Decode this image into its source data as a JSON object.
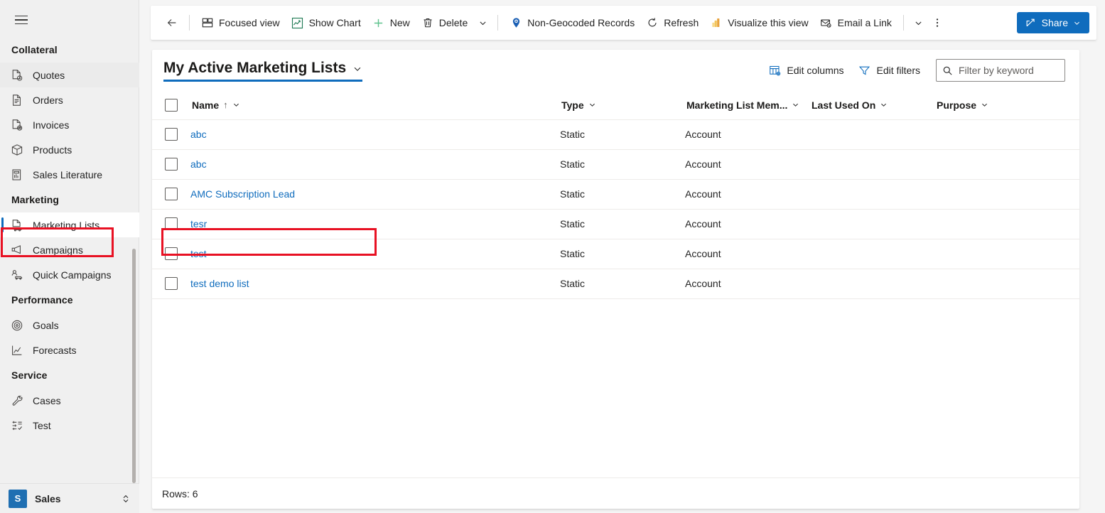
{
  "sidebar": {
    "hamburger_label": "site-map-toggle",
    "groups": [
      {
        "title": "Collateral",
        "items": [
          {
            "label": "Quotes",
            "icon": "quote-document-icon",
            "state": "hovered"
          },
          {
            "label": "Orders",
            "icon": "order-document-icon",
            "state": "normal"
          },
          {
            "label": "Invoices",
            "icon": "invoice-document-icon",
            "state": "normal"
          },
          {
            "label": "Products",
            "icon": "product-box-icon",
            "state": "normal"
          },
          {
            "label": "Sales Literature",
            "icon": "sales-literature-icon",
            "state": "normal"
          }
        ]
      },
      {
        "title": "Marketing",
        "items": [
          {
            "label": "Marketing Lists",
            "icon": "marketing-list-icon",
            "state": "selected"
          },
          {
            "label": "Campaigns",
            "icon": "megaphone-icon",
            "state": "normal"
          },
          {
            "label": "Quick Campaigns",
            "icon": "quick-campaign-icon",
            "state": "normal"
          }
        ]
      },
      {
        "title": "Performance",
        "items": [
          {
            "label": "Goals",
            "icon": "target-icon",
            "state": "normal"
          },
          {
            "label": "Forecasts",
            "icon": "line-chart-icon",
            "state": "normal"
          }
        ]
      },
      {
        "title": "Service",
        "items": [
          {
            "label": "Cases",
            "icon": "wrench-icon",
            "state": "normal"
          },
          {
            "label": "Test",
            "icon": "settings-list-icon",
            "state": "normal"
          }
        ]
      }
    ],
    "app_switcher": {
      "badge": "S",
      "name": "Sales",
      "chevron": "app-switcher-chevron-icon"
    }
  },
  "commandbar": {
    "back": "back-arrow-icon",
    "buttons": [
      {
        "label": "Focused view",
        "icon": "focused-view-icon"
      },
      {
        "label": "Show Chart",
        "icon": "show-chart-icon"
      },
      {
        "label": "New",
        "icon": "plus-icon"
      },
      {
        "label": "Delete",
        "icon": "trash-icon"
      }
    ],
    "overflow_caret_1": "chevron-down-icon",
    "buttons2": [
      {
        "label": "Non-Geocoded Records",
        "icon": "map-pin-icon"
      },
      {
        "label": "Refresh",
        "icon": "refresh-icon"
      },
      {
        "label": "Visualize this view",
        "icon": "power-bi-icon"
      },
      {
        "label": "Email a Link",
        "icon": "email-link-icon"
      }
    ],
    "overflow_caret_2": "chevron-down-icon",
    "more_commands": "more-vertical-icon",
    "share": {
      "label": "Share",
      "icon": "share-icon",
      "caret": "chevron-down-icon",
      "color": "#0f6cbd"
    }
  },
  "view_header": {
    "title": "My Active Marketing Lists",
    "title_caret": "chevron-down-icon",
    "edit_columns": {
      "label": "Edit columns",
      "icon": "edit-columns-icon"
    },
    "edit_filters": {
      "label": "Edit filters",
      "icon": "filter-icon"
    },
    "search": {
      "placeholder": "Filter by keyword",
      "value": "",
      "icon": "search-icon"
    }
  },
  "grid": {
    "select_all": "select-all-checkbox",
    "columns": [
      {
        "label": "Name",
        "sort": "↑",
        "caret": "chevron-down-icon"
      },
      {
        "label": "Type",
        "sort": "",
        "caret": "chevron-down-icon"
      },
      {
        "label": "Marketing List Mem...",
        "sort": "",
        "caret": "chevron-down-icon"
      },
      {
        "label": "Last Used On",
        "sort": "",
        "caret": "chevron-down-icon"
      },
      {
        "label": "Purpose",
        "sort": "",
        "caret": "chevron-down-icon"
      }
    ],
    "rows": [
      {
        "name": "abc",
        "type": "Static",
        "member": "Account",
        "last_used_on": "",
        "purpose": ""
      },
      {
        "name": "abc",
        "type": "Static",
        "member": "Account",
        "last_used_on": "",
        "purpose": ""
      },
      {
        "name": "AMC Subscription Lead",
        "type": "Static",
        "member": "Account",
        "last_used_on": "",
        "purpose": ""
      },
      {
        "name": "tesr",
        "type": "Static",
        "member": "Account",
        "last_used_on": "",
        "purpose": ""
      },
      {
        "name": "test",
        "type": "Static",
        "member": "Account",
        "last_used_on": "",
        "purpose": ""
      },
      {
        "name": "test demo list",
        "type": "Static",
        "member": "Account",
        "last_used_on": "",
        "purpose": ""
      }
    ],
    "footer": "Rows: 6"
  },
  "annotations": {
    "highlight_color": "#e81123",
    "sidebar_highlight_target": "Marketing Lists",
    "row_highlight_target": "AMC Subscription Lead"
  }
}
